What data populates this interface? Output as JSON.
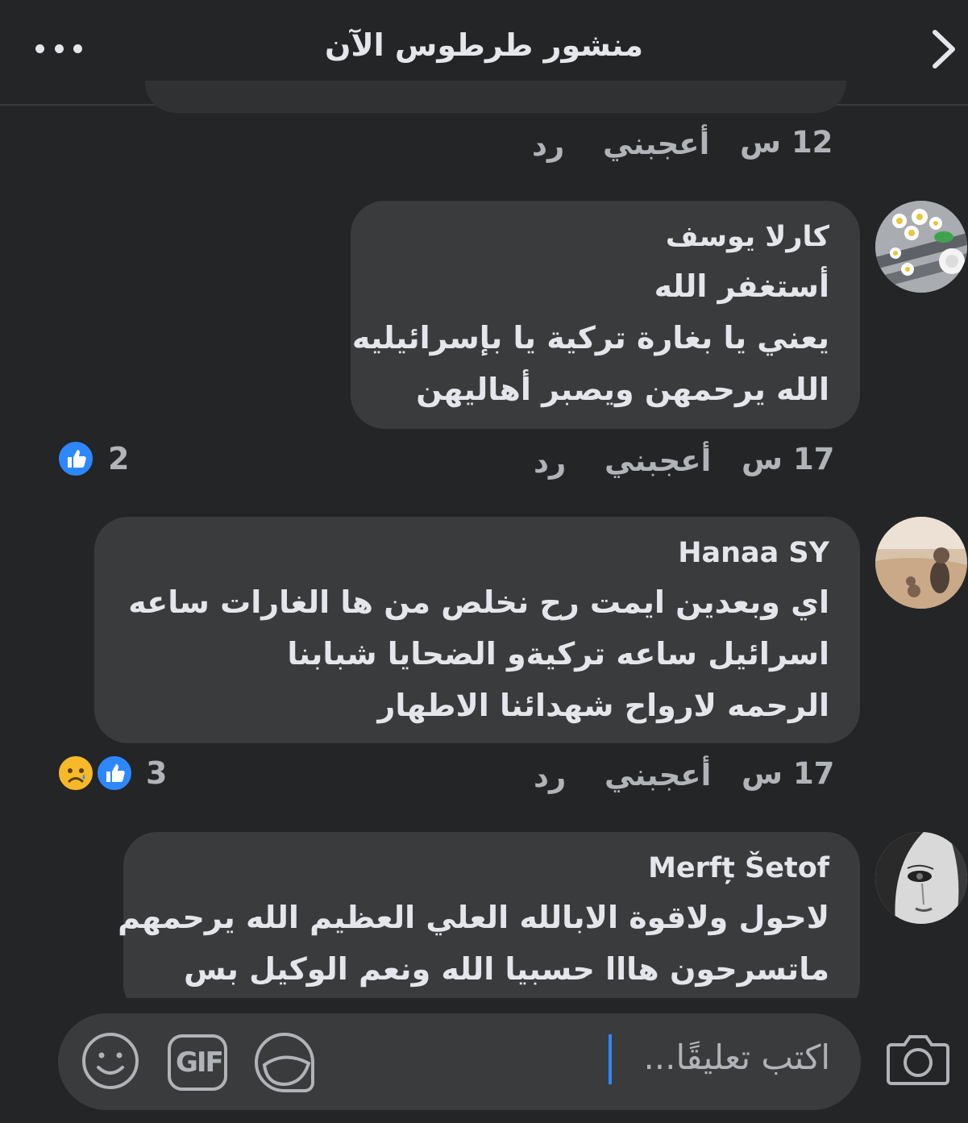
{
  "header": {
    "title": "منشور طرطوس الآن",
    "more_icon": "more-horizontal-icon",
    "back_icon": "chevron-right-icon"
  },
  "top_actions": {
    "time": "12 س",
    "like": "أعجبني",
    "reply": "رد"
  },
  "comments": [
    {
      "author": "كارلا يوسف",
      "avatar": "daisies-avatar",
      "lines": [
        "أستغفر الله",
        "يعني يا بغارة تركية يا بإسرائيليه",
        "الله يرحمهن ويصبر أهاليهن"
      ],
      "time": "17 س",
      "like": "أعجبني",
      "reply": "رد",
      "reaction_count": "2",
      "reactions": [
        "like"
      ]
    },
    {
      "author": "Hanaa SY",
      "avatar": "beach-woman-avatar",
      "lines": [
        "اي وبعدين ايمت رح نخلص من ها الغارات ساعه",
        "اسرائيل ساعه تركيةو الضحايا شبابنا",
        "الرحمه لارواح شهدائنا الاطهار"
      ],
      "time": "17 س",
      "like": "أعجبني",
      "reply": "رد",
      "reaction_count": "3",
      "reactions": [
        "like",
        "sad"
      ]
    },
    {
      "author": "Merfț Šetof",
      "avatar": "crying-face-avatar",
      "lines": [
        "لاحول ولاقوة الابالله العلي العظيم الله يرحمهم",
        "ماتسرحون هااا حسبيا الله ونعم الوكيل بس"
      ]
    }
  ],
  "composer": {
    "placeholder": "اكتب تعليقًا...",
    "icons": [
      "camera-icon",
      "sticker-icon",
      "gif-icon",
      "emoji-icon"
    ],
    "gif_label": "GIF"
  },
  "colors": {
    "background": "#242526",
    "bubble": "#3a3b3c",
    "accent": "#2d88ff",
    "secondary_text": "#b0b3b8"
  }
}
